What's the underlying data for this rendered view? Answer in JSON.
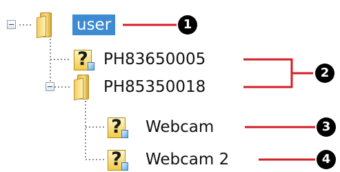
{
  "tree": {
    "nodes": [
      {
        "id": "user",
        "label": "user",
        "icon": "folder-icon",
        "selected": true,
        "expanded": true
      },
      {
        "id": "ph1",
        "label": "PH83650005",
        "icon": "unknown-device-icon"
      },
      {
        "id": "ph2",
        "label": "PH85350018",
        "icon": "folder-icon",
        "expanded": true
      },
      {
        "id": "webcam",
        "label": "Webcam",
        "icon": "unknown-device-icon"
      },
      {
        "id": "webcam2",
        "label": "Webcam 2",
        "icon": "unknown-device-icon"
      }
    ],
    "unknown_glyph": "?"
  },
  "callouts": [
    {
      "number": "❶",
      "label": "1"
    },
    {
      "number": "❷",
      "label": "2"
    },
    {
      "number": "❸",
      "label": "3"
    },
    {
      "number": "❹",
      "label": "4"
    }
  ],
  "colors": {
    "selection": "#3d8bd2",
    "callout_line": "#d11f26",
    "tree_dots": "#8f8f8f"
  }
}
